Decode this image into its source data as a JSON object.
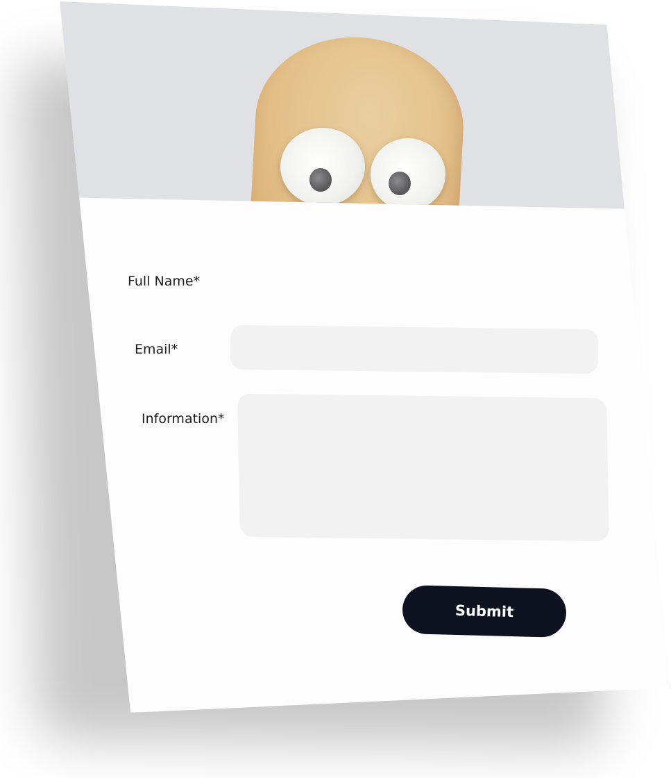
{
  "form": {
    "full_name_label": "Full Name*",
    "email_label": "Email*",
    "information_label": "Information*",
    "email_value": "",
    "information_value": "",
    "submit_label": "Submit"
  },
  "colors": {
    "hero_background": "#dfe1e5",
    "field_background": "#f2f2f2",
    "button_background": "#0e1220",
    "button_text": "#ffffff"
  },
  "icons": {
    "hero": "mascot-illustration"
  }
}
